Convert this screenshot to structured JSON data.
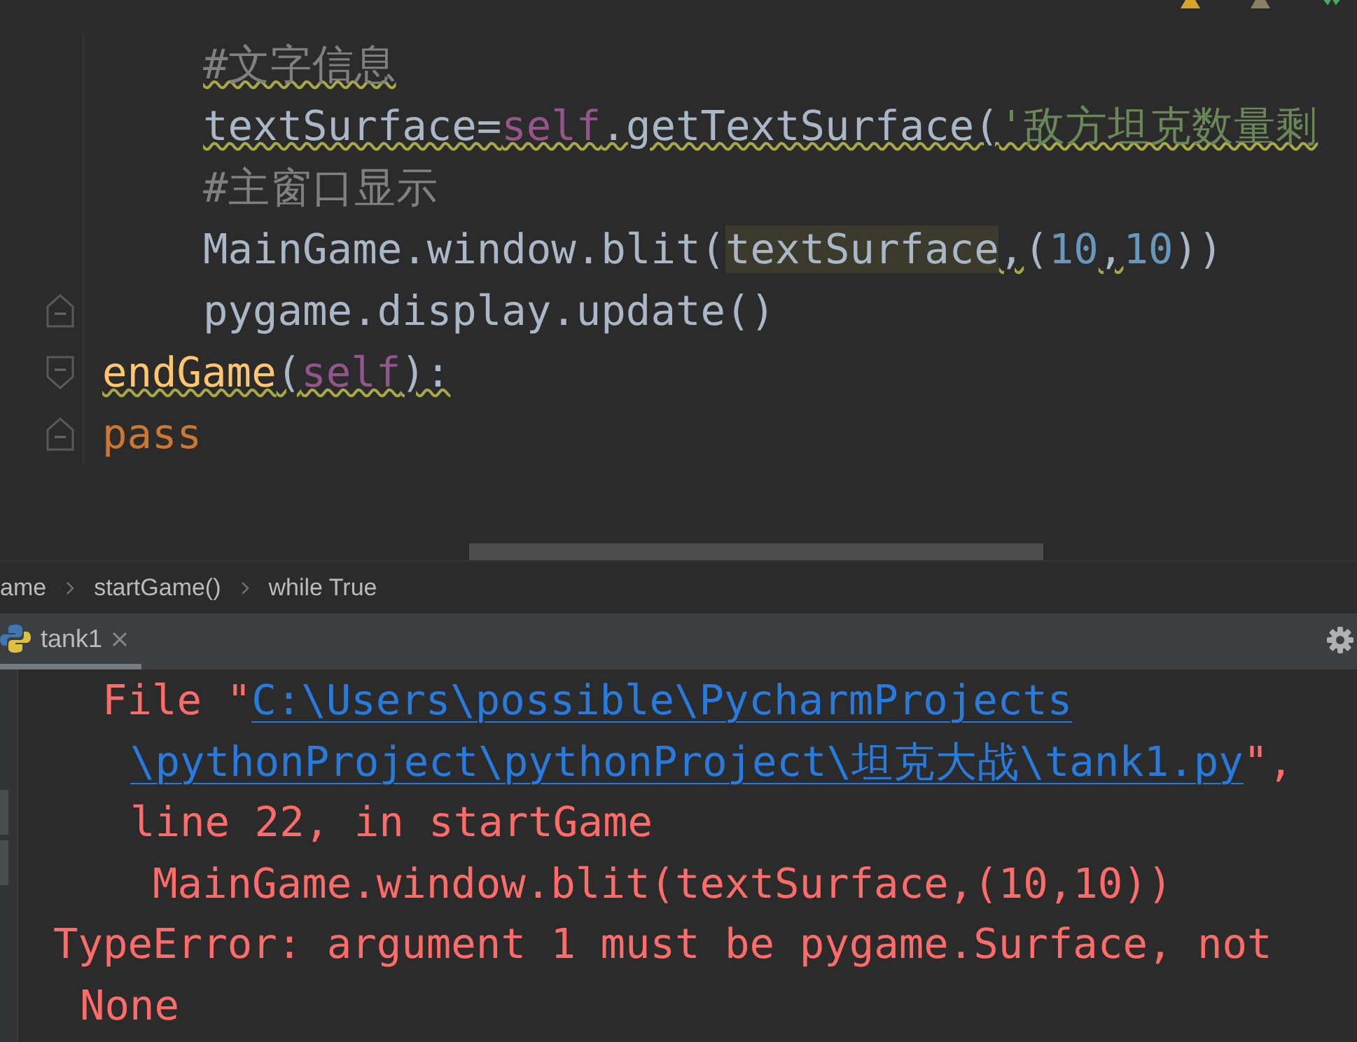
{
  "editor": {
    "lines": [
      {
        "kind": "group",
        "children": [
          {
            "kind": "code",
            "tokens": [
              {
                "kind": "comment",
                "text": "#文字信息",
                "squiggle": true,
                "highlight": false
              }
            ]
          },
          {
            "kind": "code",
            "tokens": [
              {
                "kind": "plain",
                "text": "textSurface=",
                "squiggle": true,
                "highlight": false
              },
              {
                "kind": "self",
                "text": "self",
                "squiggle": true,
                "highlight": false
              },
              {
                "kind": "plain",
                "text": ".getTextSurface(",
                "squiggle": true,
                "highlight": false
              },
              {
                "kind": "string",
                "text": "'敌方坦克数量剩",
                "squiggle": true,
                "highlight": false
              }
            ]
          },
          {
            "kind": "code",
            "tokens": [
              {
                "kind": "comment",
                "text": "#主窗口显示",
                "squiggle": false,
                "highlight": false
              }
            ]
          },
          {
            "kind": "code",
            "tokens": [
              {
                "kind": "plain",
                "text": "MainGame.window.blit(",
                "squiggle": false,
                "highlight": false
              },
              {
                "kind": "plain",
                "text": "textSurface",
                "squiggle": false,
                "highlight": true
              },
              {
                "kind": "plain",
                "text": ",",
                "squiggle": true,
                "highlight": false
              },
              {
                "kind": "plain",
                "text": "(",
                "squiggle": false,
                "highlight": false
              },
              {
                "kind": "number",
                "text": "10",
                "squiggle": false,
                "highlight": false
              },
              {
                "kind": "plain",
                "text": ",",
                "squiggle": true,
                "highlight": false
              },
              {
                "kind": "number",
                "text": "10",
                "squiggle": false,
                "highlight": false
              },
              {
                "kind": "plain",
                "text": "))",
                "squiggle": false,
                "highlight": false
              }
            ]
          },
          {
            "kind": "fold_end",
            "tokens": [
              {
                "kind": "plain",
                "text": "pygame.display.update()",
                "squiggle": false,
                "highlight": false
              }
            ]
          }
        ]
      },
      {
        "kind": "fold_start",
        "tokens": [
          {
            "kind": "func",
            "text": "endGame",
            "squiggle": true,
            "highlight": false
          },
          {
            "kind": "plain",
            "text": "(",
            "squiggle": true,
            "highlight": false
          },
          {
            "kind": "self",
            "text": "self",
            "squiggle": true,
            "highlight": false
          },
          {
            "kind": "plain",
            "text": "):",
            "squiggle": true,
            "highlight": false
          }
        ]
      },
      {
        "kind": "fold_end",
        "tokens": [
          {
            "kind": "keyword",
            "text": "pass",
            "squiggle": false,
            "highlight": false
          }
        ]
      }
    ]
  },
  "breadcrumbs": [
    "ame",
    "startGame()",
    "while True"
  ],
  "run_tabs": [
    {
      "label": "tank1",
      "selected": true
    }
  ],
  "console": {
    "lines": [
      {
        "kind": "file",
        "segments": [
          {
            "kind": "error",
            "text": "File \""
          },
          {
            "kind": "link",
            "text": "C:\\Users\\possible\\PycharmProjects"
          }
        ]
      },
      {
        "kind": "continuation",
        "segments": [
          {
            "kind": "link",
            "text": "\\pythonProject\\pythonProject\\坦克大战\\tank1.py"
          },
          {
            "kind": "error",
            "text": "\","
          }
        ]
      },
      {
        "kind": "continuation",
        "segments": [
          {
            "kind": "error",
            "text": "line 22, in startGame"
          }
        ]
      },
      {
        "kind": "source",
        "segments": [
          {
            "kind": "error",
            "text": "MainGame.window.blit(textSurface,(10,10))"
          }
        ]
      },
      {
        "kind": "exception",
        "segments": [
          {
            "kind": "error",
            "text": "TypeError: argument 1 must be pygame.Surface, not"
          }
        ]
      },
      {
        "kind": "exception_continuation",
        "segments": [
          {
            "kind": "error",
            "text": "None"
          }
        ]
      }
    ]
  }
}
